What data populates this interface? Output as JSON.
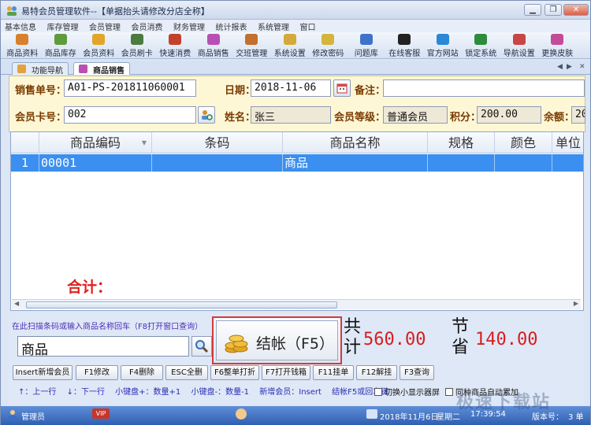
{
  "window": {
    "title": "易特会员管理软件--【单据抬头请修改分店全称】",
    "controls": [
      "minimize",
      "restore",
      "close"
    ]
  },
  "menu": [
    "基本信息",
    "库存管理",
    "会员管理",
    "会员消费",
    "财务管理",
    "统计报表",
    "系统管理",
    "窗口"
  ],
  "toolbar": [
    {
      "label": "商品资料",
      "icon": "goods-icon",
      "color": "#d9802c"
    },
    {
      "label": "商品库存",
      "icon": "stock-icon",
      "color": "#5e9b3b"
    },
    {
      "label": "会员资料",
      "icon": "member-icon",
      "color": "#e2a52a"
    },
    {
      "label": "会员刷卡",
      "icon": "card-icon",
      "color": "#4a7c3d"
    },
    {
      "label": "快速消费",
      "icon": "quick-pay-icon",
      "color": "#c2412d"
    },
    {
      "label": "商品销售",
      "icon": "sale-icon",
      "color": "#b84fb5"
    },
    {
      "label": "交班管理",
      "icon": "shift-icon",
      "color": "#c3702e"
    },
    {
      "label": "系统设置",
      "icon": "settings-icon",
      "color": "#d4a93a"
    },
    {
      "label": "修改密码",
      "icon": "password-icon",
      "color": "#d4b43a"
    },
    {
      "label": "问题库",
      "icon": "faq-icon",
      "color": "#3f73c9"
    },
    {
      "label": "在线客服",
      "icon": "qq-icon",
      "color": "#222222"
    },
    {
      "label": "官方网站",
      "icon": "ie-icon",
      "color": "#2b87d8"
    },
    {
      "label": "锁定系统",
      "icon": "lock-icon",
      "color": "#2d8c3b"
    },
    {
      "label": "导航设置",
      "icon": "nav-icon",
      "color": "#c84646"
    },
    {
      "label": "更换皮肤",
      "icon": "skin-icon",
      "color": "#c44a9a"
    }
  ],
  "tabs": [
    {
      "label": "功能导航",
      "active": false
    },
    {
      "label": "商品销售",
      "active": true
    }
  ],
  "form": {
    "order_label": "销售单号：",
    "order_value": "A01-PS-201811060001",
    "date_label": "日期：",
    "date_value": "2018-11-06",
    "note_label": "备注：",
    "note_value": "",
    "card_label": "会员卡号：",
    "card_value": "002",
    "name_label": "姓名：",
    "name_value": "张三",
    "level_label": "会员等级：",
    "level_value": "普通会员",
    "points_label": "积分：",
    "points_value": "200.00",
    "balance_label": "余额：",
    "balance_value": "20"
  },
  "grid": {
    "columns": [
      "",
      "商品编码",
      "条码",
      "商品名称",
      "规格",
      "颜色",
      "单位"
    ],
    "rows": [
      {
        "index": "1",
        "code": "00001",
        "barcode": "",
        "name": "商品",
        "spec": "",
        "color": "",
        "unit": ""
      }
    ],
    "total_label": "合计："
  },
  "scan": {
    "hint": "在此扫描条码或输入商品名称回车（F8打开窗口查询）",
    "value": "商品"
  },
  "checkout": {
    "label": "结帐（F5）",
    "total_word": [
      "共",
      "计"
    ],
    "total_value": "560.00",
    "save_word": [
      "节",
      "省"
    ],
    "save_value": "140.00"
  },
  "buttons": [
    "Insert新增会员",
    "F1修改",
    "F4删除",
    "ESC全删",
    "F6整单打折",
    "F7打开钱箱",
    "F11挂单",
    "F12解挂",
    "F3查询"
  ],
  "shortcuts": [
    "↑：上一行",
    "↓：下一行",
    "小键盘+：数量+1",
    "小键盘-：数量-1",
    "新增会员：Insert",
    "结帐F5或回车键"
  ],
  "checkboxes": [
    "切换小显示器屏",
    "同种商品自动累加"
  ],
  "status": {
    "user": "管理员",
    "date": "2018年11月6日",
    "weekday": "星期二",
    "time": "17:39:54",
    "version": "版本号：",
    "version_tail": "3  单"
  },
  "watermark": "极速下载站"
}
